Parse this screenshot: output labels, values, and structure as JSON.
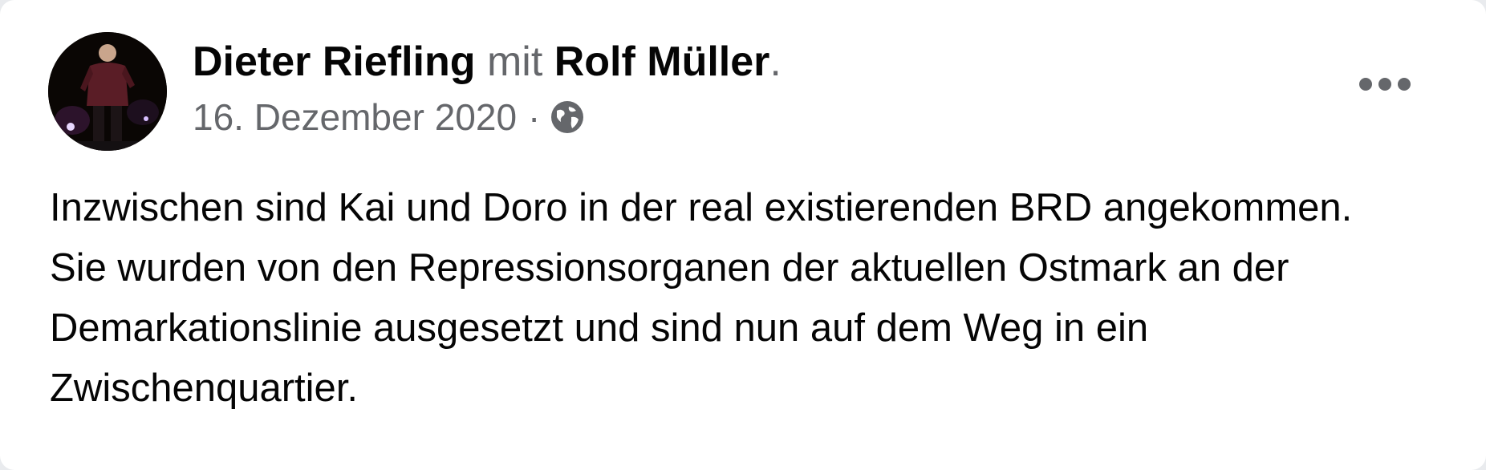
{
  "post": {
    "author": "Dieter Riefling",
    "with_word": "mit",
    "tagged": "Rolf Müller",
    "tagged_suffix": ".",
    "date": "16. Dezember 2020",
    "separator": "·",
    "audience_icon": "globe-icon",
    "more_icon": "more-options-icon",
    "paragraphs": [
      "Inzwischen sind Kai und Doro in der real existierenden BRD angekommen.",
      "Sie wurden von den Repressionsorganen der aktuellen Ostmark an der Demarkationslinie ausgesetzt und sind nun auf dem Weg in ein Zwischenquartier."
    ]
  },
  "colors": {
    "background": "#ffffff",
    "primary_text": "#050505",
    "secondary_text": "#65676b"
  }
}
